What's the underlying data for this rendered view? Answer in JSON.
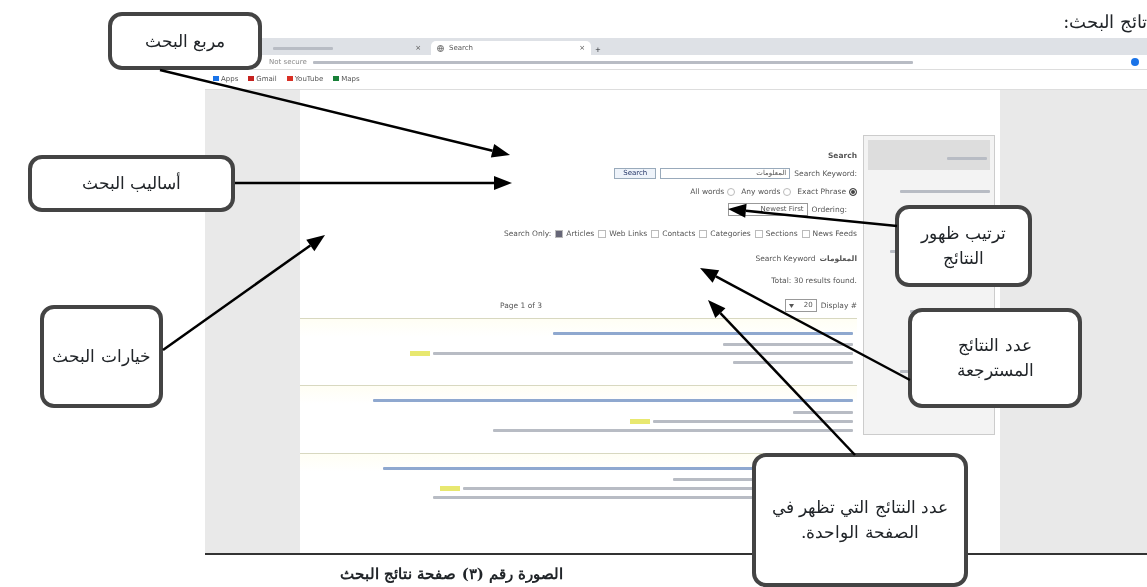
{
  "document_heading": "تائج البحث:",
  "browser": {
    "tabs": [
      {
        "label": "Search",
        "selected": true,
        "close": "×"
      },
      {
        "selected": false,
        "close": "×"
      }
    ],
    "new_tab": "+",
    "security": "Not secure",
    "bookmarks": [
      {
        "label": "Maps"
      },
      {
        "label": "YouTube"
      },
      {
        "label": "Gmail"
      },
      {
        "label": "Apps"
      }
    ]
  },
  "search_page": {
    "heading": "Search",
    "keyword_label": "Search Keyword:",
    "keyword_value": "المعلومات",
    "search_button": "Search",
    "match_options": [
      {
        "label": "Exact Phrase",
        "selected": true
      },
      {
        "label": "Any words",
        "selected": false
      },
      {
        "label": "All words",
        "selected": false
      }
    ],
    "ordering_label": "Ordering:",
    "ordering_value": "Newest First",
    "search_only_label": "Search Only:",
    "areas": [
      {
        "label": "News Feeds",
        "checked": false
      },
      {
        "label": "Sections",
        "checked": false
      },
      {
        "label": "Categories",
        "checked": false
      },
      {
        "label": "Contacts",
        "checked": false
      },
      {
        "label": "Web Links",
        "checked": false
      },
      {
        "label": "Articles",
        "checked": true
      }
    ],
    "summary_keyword_label": "Search Keyword",
    "summary_keyword": "المعلومات",
    "total": "Total: 30 results found.",
    "display_label": "Display #",
    "display_value": "20",
    "page_info": "Page 1 of 3"
  },
  "callouts": [
    {
      "text": "مربع البحث"
    },
    {
      "text": "أساليب البحث"
    },
    {
      "text": "خيارات البحث"
    },
    {
      "text": "ترتيب ظهور النتائج"
    },
    {
      "text": "عدد النتائج المسترجعة"
    },
    {
      "text": "عدد النتائج التي تظهر في الصفحة الواحدة."
    }
  ],
  "caption": "الصورة رقم (٣) صفحة نتائج البحث"
}
